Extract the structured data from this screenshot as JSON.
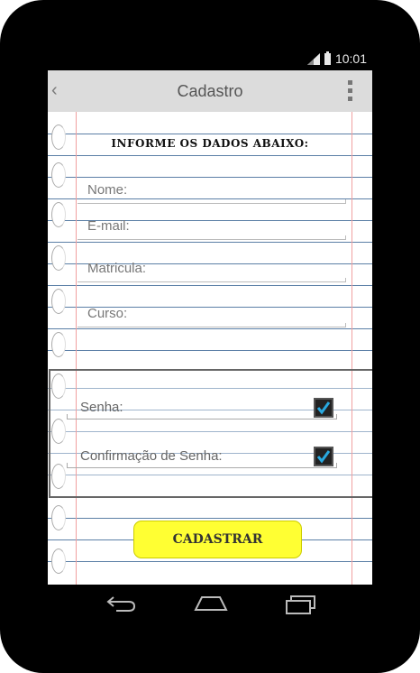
{
  "status_bar": {
    "time": "10:01"
  },
  "action_bar": {
    "title": "Cadastro"
  },
  "form": {
    "heading": "INFORME OS DADOS ABAIXO:",
    "fields": [
      {
        "label": "Nome:"
      },
      {
        "label": "E-mail:"
      },
      {
        "label": "Matricula:"
      },
      {
        "label": "Curso:"
      }
    ],
    "password_fields": [
      {
        "label": "Senha:",
        "checked": true
      },
      {
        "label": "Confirmação de Senha:",
        "checked": true
      }
    ],
    "submit_label": "CADASTRAR"
  },
  "colors": {
    "accent_button": "#ffff33",
    "checkbox_check": "#29a9e0",
    "rule_line": "#5b7fa6",
    "margin_line": "#f0a0a0"
  },
  "icons": {
    "action_bar": [
      "chevron-left-icon",
      "overflow-menu-icon"
    ],
    "status_bar": [
      "signal-icon",
      "battery-icon"
    ],
    "navigation": [
      "back-icon",
      "home-icon",
      "recents-icon"
    ]
  }
}
